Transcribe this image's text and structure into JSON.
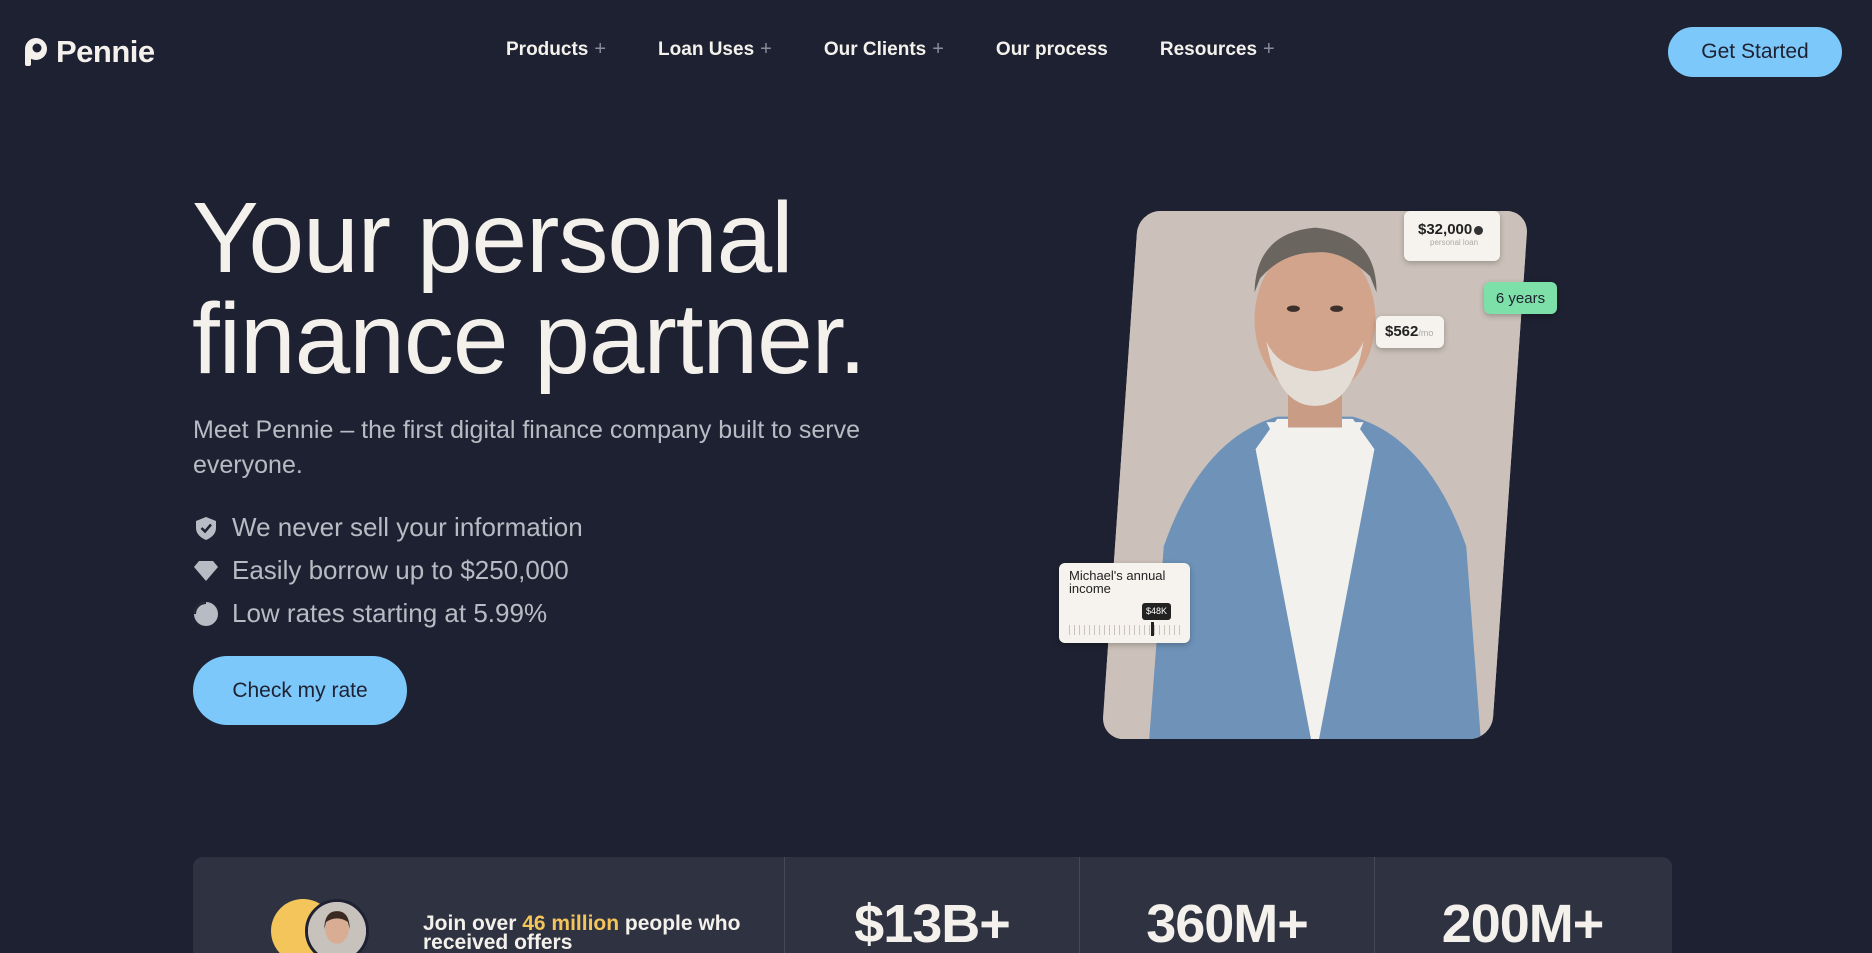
{
  "header": {
    "logo_text": "Pennie",
    "nav": [
      {
        "label": "Products",
        "has_plus": true
      },
      {
        "label": "Loan Uses",
        "has_plus": true
      },
      {
        "label": "Our Clients",
        "has_plus": true
      },
      {
        "label": "Our process",
        "has_plus": false
      },
      {
        "label": "Resources",
        "has_plus": true
      }
    ],
    "plus_symbol": "+",
    "cta_label": "Get Started"
  },
  "hero": {
    "title_line1": "Your personal",
    "title_line2": "finance partner.",
    "subtitle": "Meet Pennie – the first digital finance company built to serve everyone.",
    "features": [
      {
        "icon": "shield-check-icon",
        "text": "We never sell your information"
      },
      {
        "icon": "diamond-icon",
        "text": "Easily borrow up to $250,000"
      },
      {
        "icon": "pie-chart-icon",
        "text": "Low rates starting at 5.99%"
      }
    ],
    "cta_label": "Check my rate"
  },
  "hero_card": {
    "loan_amount": "$32,000",
    "loan_caption": "personal loan",
    "term": "6 years",
    "monthly": "$562",
    "monthly_unit": "/mo",
    "income_label": "Michael's annual income",
    "income_value": "$48K"
  },
  "stats": {
    "join_prefix": "Join over ",
    "join_highlight": "46 million",
    "join_suffix": " people who received offers",
    "values": [
      "$13B+",
      "360M+",
      "200M+"
    ]
  },
  "colors": {
    "background": "#1e2131",
    "accent_blue": "#7cc8fa",
    "accent_green": "#7ee0a9",
    "accent_yellow": "#f4c55a",
    "text_light": "#f4f1ec",
    "text_muted": "#b9bbc4"
  }
}
